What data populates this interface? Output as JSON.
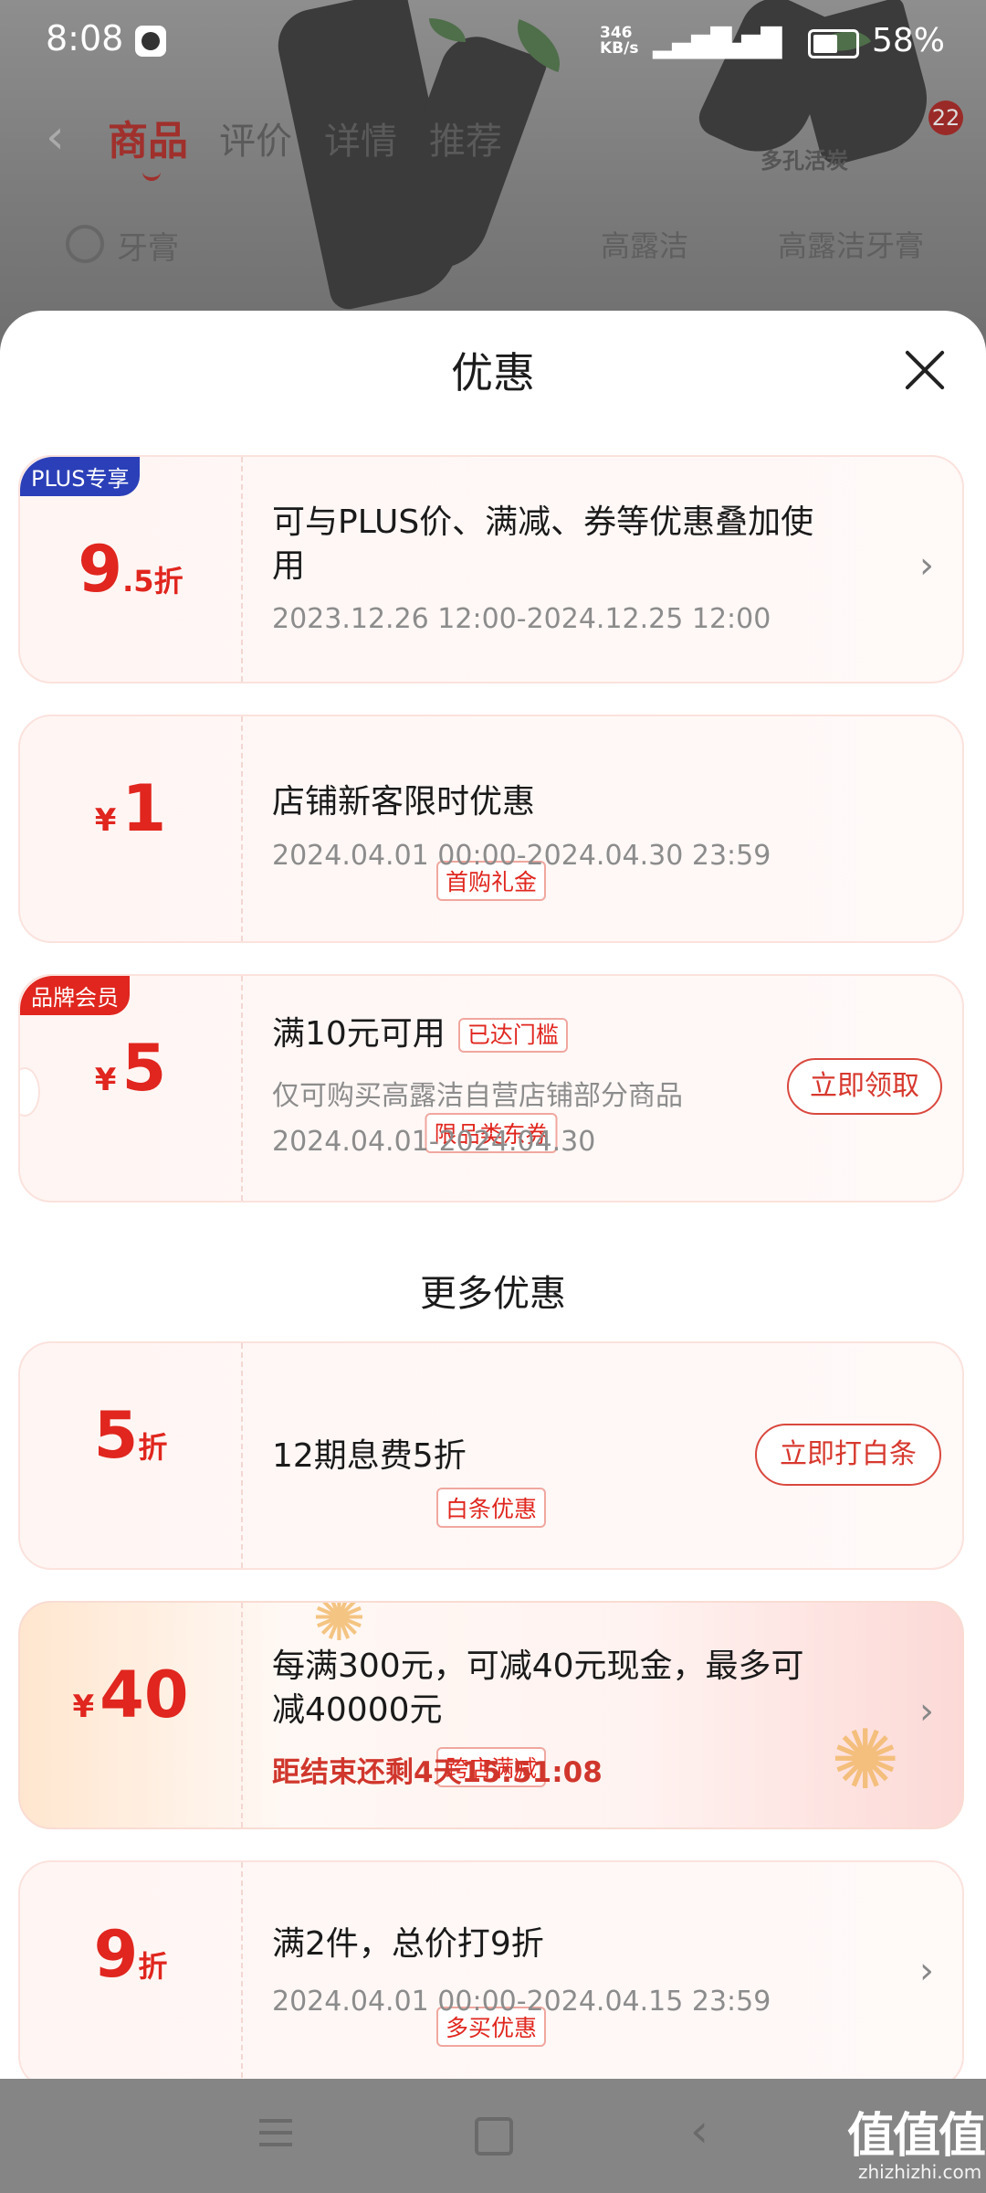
{
  "status_bar": {
    "time": "8:08",
    "net_speed_value": "346",
    "net_speed_unit": "KB/s",
    "battery": "58%"
  },
  "top_nav": {
    "tabs": [
      "商品",
      "评价",
      "详情",
      "推荐"
    ],
    "badge": "22",
    "shop_label": "多孔活炭"
  },
  "search": {
    "query": "牙膏",
    "hints": [
      "高露洁",
      "高露洁牙膏"
    ]
  },
  "sheet": {
    "title": "优惠",
    "section_more": "更多优惠",
    "cards": [
      {
        "corner": "PLUS专享",
        "value_int": "9",
        "value_dec": ".5",
        "value_unit": "折",
        "desc": "可与PLUS价、满减、券等优惠叠加使用",
        "date": "2023.12.26 12:00-2024.12.25 12:00"
      },
      {
        "currency": "¥",
        "value": "1",
        "tag": "首购礼金",
        "desc": "店铺新客限时优惠",
        "date": "2024.04.01 00:00-2024.04.30 23:59"
      },
      {
        "corner": "品牌会员",
        "currency": "¥",
        "value": "5",
        "tag": "限品类东券",
        "desc": "满10元可用",
        "pill": "已达门槛",
        "scope": "仅可购买高露洁自营店铺部分商品",
        "date": "2024.04.01-2024.04.30",
        "button": "立即领取"
      },
      {
        "value": "5",
        "value_unit": "折",
        "tag": "白条优惠",
        "desc": "12期息费5折",
        "button": "立即打白条"
      },
      {
        "currency": "¥",
        "value": "40",
        "tag": "跨店满减",
        "desc": "每满300元，可减40元现金，最多可减40000元",
        "countdown": "距结束还剩4天15:51:08"
      },
      {
        "value": "9",
        "value_unit": "折",
        "tag": "多买优惠",
        "desc": "满2件，总价打9折",
        "date": "2024.04.01 00:00-2024.04.15 23:59"
      }
    ]
  },
  "watermark": {
    "logo": "值值值",
    "site": "zhizhizhi.com"
  },
  "colors": {
    "accent_red": "#e0261e",
    "card_bg": "#fff6f4",
    "plus_blue": "#2b3fb8",
    "member_red": "#e0261e"
  }
}
